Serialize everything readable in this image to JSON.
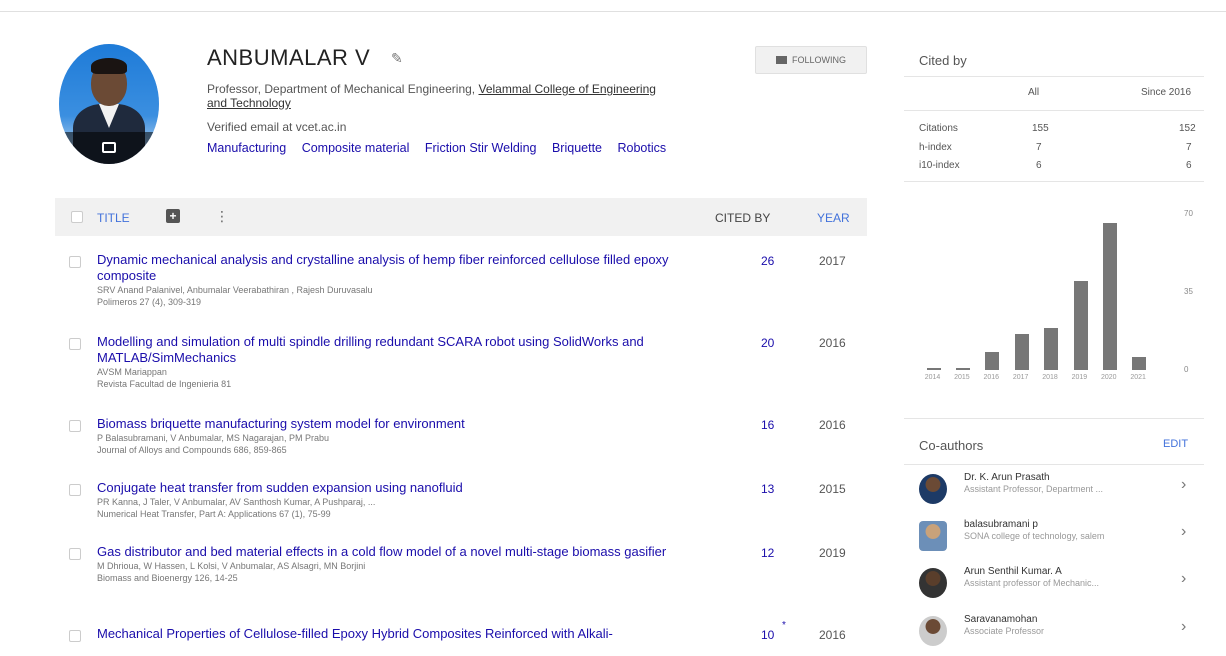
{
  "profile": {
    "name": "ANBUMALAR V",
    "affiliation_prefix": "Professor, Department of Mechanical Engineering, ",
    "affiliation_link": "Velammal College of Engineering and Technology",
    "email": "Verified email at vcet.ac.in",
    "interests": [
      "Manufacturing",
      "Composite material",
      "Friction Stir Welding",
      "Briquette",
      "Robotics"
    ],
    "follow_label": "FOLLOWING"
  },
  "table": {
    "title_label": "TITLE",
    "cited_label": "CITED BY",
    "year_label": "YEAR"
  },
  "articles": [
    {
      "title": "Dynamic mechanical analysis and crystalline analysis of hemp fiber reinforced cellulose filled epoxy composite",
      "authors": "SRV Anand Palanivel, Anbumalar Veerabathiran , Rajesh Duruvasalu",
      "venue": "Polimeros 27 (4), 309-319",
      "cited": "26",
      "year": "2017"
    },
    {
      "title": "Modelling and simulation of multi spindle drilling redundant SCARA robot using SolidWorks and MATLAB/SimMechanics",
      "authors": "AVSM Mariappan",
      "venue": "Revista Facultad de Ingenieria 81",
      "cited": "20",
      "year": "2016"
    },
    {
      "title": "Biomass briquette manufacturing system model for environment",
      "authors": "P Balasubramani, V Anbumalar, MS Nagarajan, PM Prabu",
      "venue": "Journal of Alloys and Compounds 686, 859-865",
      "cited": "16",
      "year": "2016"
    },
    {
      "title": "Conjugate heat transfer from sudden expansion using nanofluid",
      "authors": "PR Kanna, J Taler, V Anbumalar, AV Santhosh Kumar, A Pushparaj, ...",
      "venue": "Numerical Heat Transfer, Part A: Applications 67 (1), 75-99",
      "cited": "13",
      "year": "2015"
    },
    {
      "title": "Gas distributor and bed material effects in a cold flow model of a novel multi-stage biomass gasifier",
      "authors": "M Dhrioua, W Hassen, L Kolsi, V Anbumalar, AS Alsagri, MN Borjini",
      "venue": "Biomass and Bioenergy 126, 14-25",
      "cited": "12",
      "year": "2019"
    },
    {
      "title": "Mechanical Properties of Cellulose-filled Epoxy Hybrid Composites Reinforced with Alkali-",
      "authors": "",
      "venue": "",
      "cited": "10",
      "year": "2016"
    }
  ],
  "cited_by": {
    "title": "Cited by",
    "col_all": "All",
    "col_since": "Since 2016",
    "rows": [
      {
        "label": "Citations",
        "all": "155",
        "since": "152"
      },
      {
        "label": "h-index",
        "all": "7",
        "since": "7"
      },
      {
        "label": "i10-index",
        "all": "6",
        "since": "6"
      }
    ]
  },
  "chart_data": {
    "type": "bar",
    "categories": [
      "2014",
      "2015",
      "2016",
      "2017",
      "2018",
      "2019",
      "2020",
      "2021"
    ],
    "values": [
      1,
      1,
      8,
      16,
      19,
      40,
      66,
      6
    ],
    "ylim": [
      0,
      70
    ],
    "yticks": [
      "70",
      "35",
      "0"
    ],
    "color": "#777777"
  },
  "coauthors": {
    "title": "Co-authors",
    "edit_label": "EDIT",
    "items": [
      {
        "name": "Dr. K. Arun Prasath",
        "desc": "Assistant Professor, Department ..."
      },
      {
        "name": "balasubramani p",
        "desc": "SONA college of technology, salem"
      },
      {
        "name": "Arun Senthil Kumar. A",
        "desc": "Assistant professor of Mechanic..."
      },
      {
        "name": "Saravanamohan",
        "desc": "Associate Professor"
      }
    ]
  }
}
